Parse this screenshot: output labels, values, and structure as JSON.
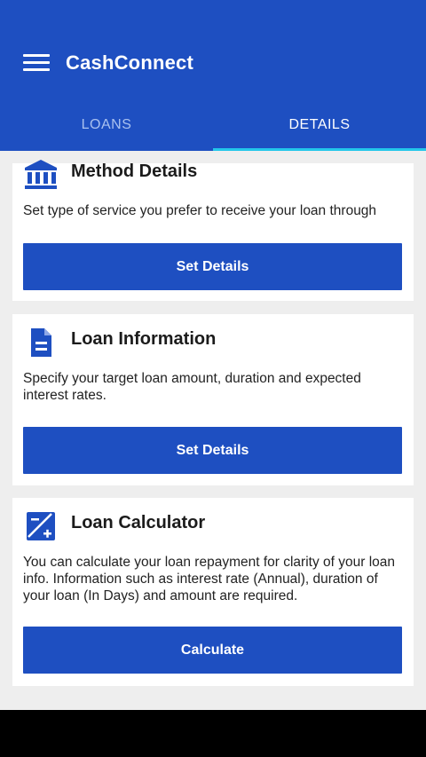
{
  "app": {
    "title": "CashConnect"
  },
  "tabs": [
    {
      "label": "LOANS"
    },
    {
      "label": "DETAILS"
    }
  ],
  "cards": [
    {
      "title": "Method Details",
      "description": "Set type of service you prefer to receive your loan through",
      "button_label": "Set Details",
      "icon": "bank-icon"
    },
    {
      "title": "Loan Information",
      "description": "Specify your target loan amount, duration and expected interest rates.",
      "button_label": "Set Details",
      "icon": "document-icon"
    },
    {
      "title": "Loan Calculator",
      "description": "You can calculate your loan repayment for clarity of your loan info. Information such as interest rate (Annual), duration of your loan (In Days) and amount are required.",
      "button_label": "Calculate",
      "icon": "calculator-icon"
    }
  ],
  "colors": {
    "primary": "#1e4fc1",
    "tab_indicator": "#23c7ea",
    "background": "#eeeeee"
  }
}
